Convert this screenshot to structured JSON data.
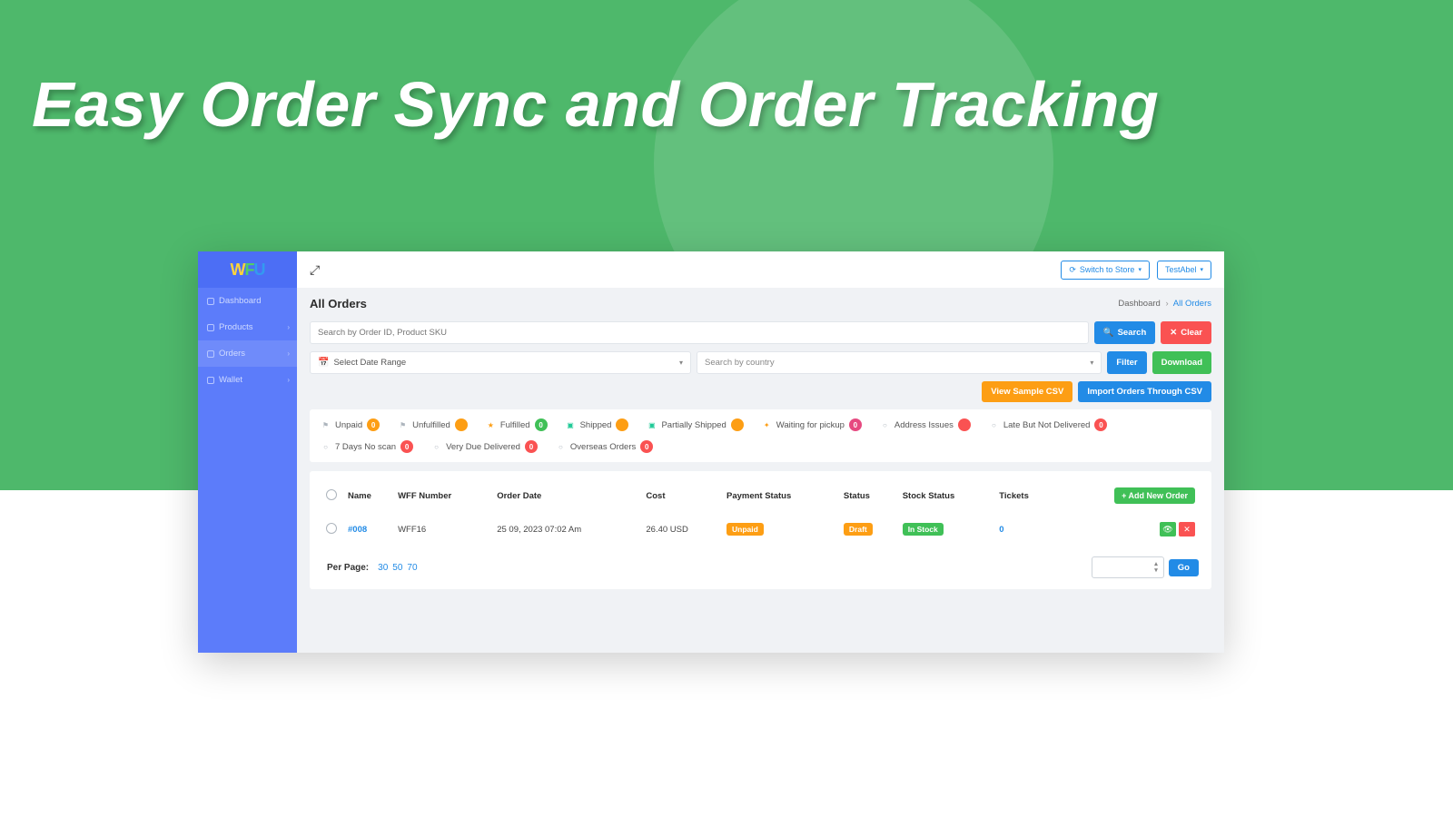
{
  "hero": {
    "title": "Easy Order Sync and Order Tracking"
  },
  "logo": {
    "p1": "W",
    "p2": "F",
    "p3": "U"
  },
  "sidebar": {
    "items": [
      {
        "label": "Dashboard",
        "expandable": false
      },
      {
        "label": "Products",
        "expandable": true
      },
      {
        "label": "Orders",
        "expandable": true
      },
      {
        "label": "Wallet",
        "expandable": true
      }
    ]
  },
  "topbar": {
    "switch_store": "Switch to Store",
    "user": "TestAbel"
  },
  "page": {
    "title": "All Orders",
    "breadcrumb": {
      "root": "Dashboard",
      "current": "All Orders"
    }
  },
  "search": {
    "placeholder": "Search by Order ID, Product SKU",
    "search_btn": "Search",
    "clear_btn": "Clear"
  },
  "filters": {
    "date_placeholder": "Select Date Range",
    "country_placeholder": "Search by country",
    "filter_btn": "Filter",
    "download_btn": "Download",
    "sample_btn": "View Sample CSV",
    "import_btn": "Import Orders Through CSV"
  },
  "status_filters": [
    {
      "icon": "flag",
      "icon_cls": "i-gray",
      "label": "Unpaid",
      "badge_cls": "b-orange",
      "count": "0"
    },
    {
      "icon": "flag",
      "icon_cls": "i-gray",
      "label": "Unfulfilled",
      "badge_cls": "b-orange",
      "count": ""
    },
    {
      "icon": "star",
      "icon_cls": "i-orange",
      "label": "Fulfilled",
      "badge_cls": "b-green",
      "count": "0"
    },
    {
      "icon": "truck",
      "icon_cls": "i-teal",
      "label": "Shipped",
      "badge_cls": "b-orange",
      "count": ""
    },
    {
      "icon": "truck",
      "icon_cls": "i-teal",
      "label": "Partially Shipped",
      "badge_cls": "b-orange",
      "count": ""
    },
    {
      "icon": "gift",
      "icon_cls": "i-orange",
      "label": "Waiting for pickup",
      "badge_cls": "b-pink",
      "count": "0"
    },
    {
      "icon": "circle",
      "icon_cls": "i-gray",
      "label": "Address Issues",
      "badge_cls": "b-red",
      "count": ""
    },
    {
      "icon": "circle",
      "icon_cls": "i-gray",
      "label": "Late But Not Delivered",
      "badge_cls": "b-red",
      "count": "0"
    },
    {
      "icon": "circle",
      "icon_cls": "i-gray",
      "label": "7 Days No scan",
      "badge_cls": "b-red",
      "count": "0"
    },
    {
      "icon": "circle",
      "icon_cls": "i-gray",
      "label": "Very Due Delivered",
      "badge_cls": "b-red",
      "count": "0"
    },
    {
      "icon": "circle",
      "icon_cls": "i-gray",
      "label": "Overseas Orders",
      "badge_cls": "b-red",
      "count": "0"
    }
  ],
  "table": {
    "headers": {
      "name": "Name",
      "wff": "WFF Number",
      "date": "Order Date",
      "cost": "Cost",
      "payment": "Payment Status",
      "status": "Status",
      "stock": "Stock Status",
      "tickets": "Tickets"
    },
    "add_btn": "+ Add New Order",
    "rows": [
      {
        "name": "#008",
        "wff": "WFF16",
        "date": "25 09, 2023 07:02 Am",
        "cost": "26.40 USD",
        "payment": {
          "text": "Unpaid",
          "cls": "b-orange"
        },
        "status": {
          "text": "Draft",
          "cls": "b-orange"
        },
        "stock": {
          "text": "In Stock",
          "cls": "b-green"
        },
        "tickets": "0"
      }
    ]
  },
  "pagination": {
    "label": "Per Page:",
    "opts": [
      "30",
      "50",
      "70"
    ],
    "go_btn": "Go"
  }
}
